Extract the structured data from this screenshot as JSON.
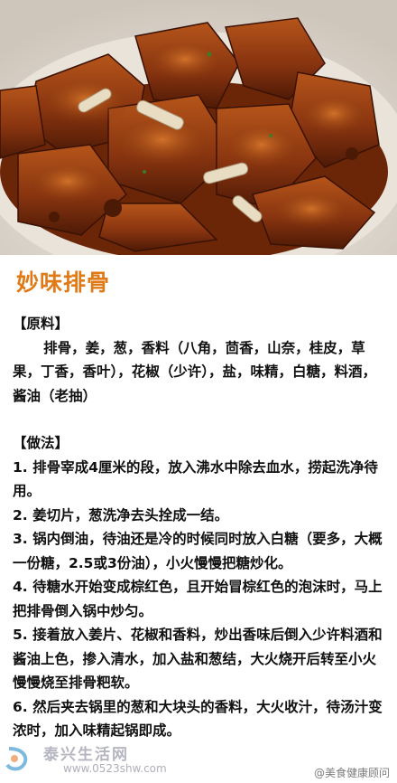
{
  "photo": {
    "alt": "",
    "icon": "braised-ribs-photo"
  },
  "title": "妙味排骨",
  "ingredients": {
    "heading": "【原料】",
    "text": "排骨，姜，葱，香料（八角，茴香，山奈，桂皮，草果，丁香，香叶），花椒（少许），盐，味精，白糖，料酒，酱油（老抽）"
  },
  "method": {
    "heading": "【做法】",
    "steps": [
      "1. 排骨宰成4厘米的段，放入沸水中除去血水，捞起洗净待用。",
      "2. 姜切片，葱洗净去头拴成一结。",
      "3. 锅内倒油，待油还是冷的时候同时放入白糖（要多，大概一份糖，2.5或3份油），小火慢慢把糖炒化。",
      "4. 待糖水开始变成棕红色，且开始冒棕红色的泡沫时，马上把排骨倒入锅中炒匀。",
      "5. 接着放入姜片、花椒和香料，炒出香味后倒入少许料酒和酱油上色，掺入清水，加入盐和葱结，大火烧开后转至小火慢慢烧至排骨粑软。",
      "6. 然后夹去锅里的葱和大块头的香料，大火收汁，待汤汁变浓时，加入味精起锅即成。"
    ]
  },
  "watermark": {
    "site": "泰兴生活网",
    "url": "www.0523shw.com",
    "weibo": "@美食健康顾问",
    "logo_icon": "site-logo-icon"
  },
  "colors": {
    "title": "#e07a16",
    "sauce": "#7a2c08"
  }
}
